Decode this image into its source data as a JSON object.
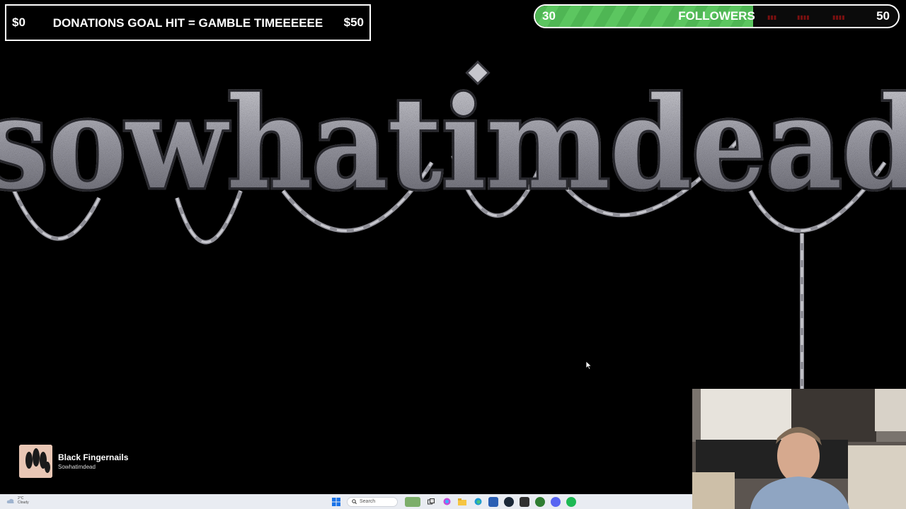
{
  "donation": {
    "start": "$0",
    "goal_text": "DONATIONS GOAL HIT = GAMBLE TIMEEEEEE",
    "end": "$50"
  },
  "followers": {
    "start": "30",
    "label": "FOLLOWERS",
    "end": "50",
    "progress_fraction": 0.6
  },
  "logo": {
    "text": "sowhatimdead"
  },
  "now_playing": {
    "title": "Black Fingernails",
    "artist": "Sowhatimdead"
  },
  "taskbar": {
    "weather_temp": "2°C",
    "weather_cond": "Cloudy",
    "search_placeholder": "Search",
    "icons": [
      "windows-start-icon",
      "search-icon",
      "widgets-icon",
      "task-view-icon",
      "copilot-icon",
      "file-explorer-icon",
      "edge-icon",
      "store-icon",
      "steam-icon",
      "obs-icon",
      "xbox-icon",
      "discord-icon",
      "spotify-icon"
    ]
  },
  "colors": {
    "followers_fill": "#5cc660",
    "background": "#000000",
    "taskbar": "#e9ecf2"
  }
}
